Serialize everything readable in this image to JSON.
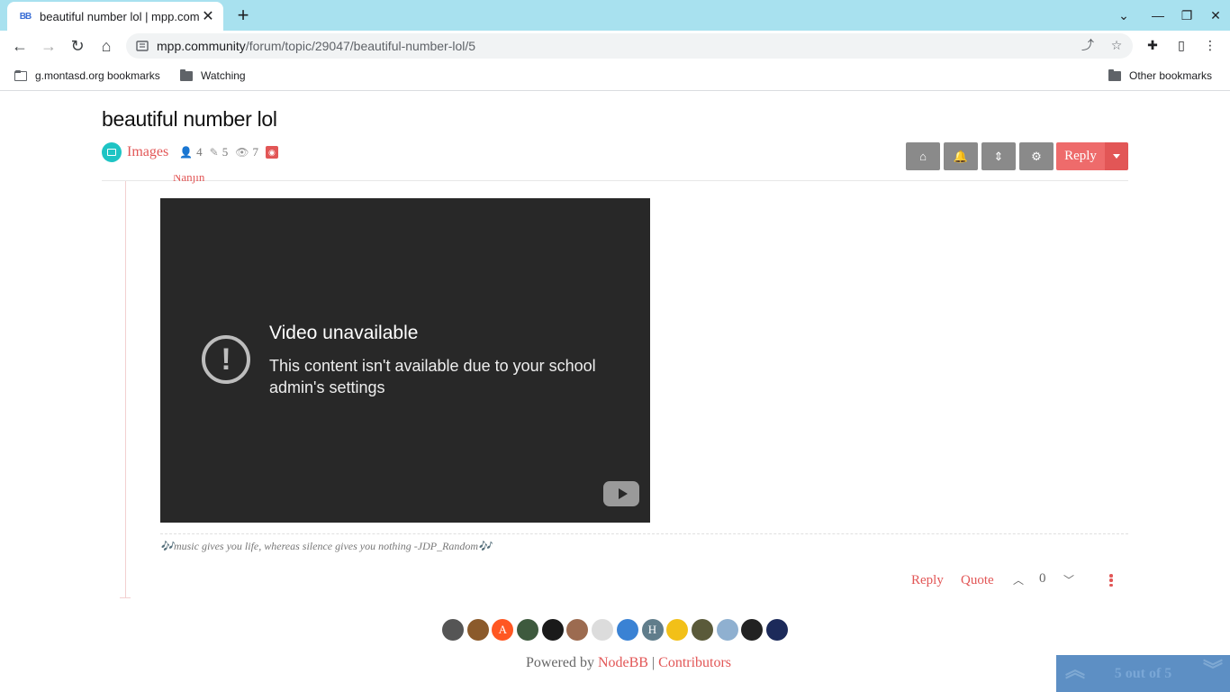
{
  "browser": {
    "tab_favicon": "BB",
    "tab_title": "beautiful number lol | mpp.community",
    "url_host": "mpp.community",
    "url_path": "/forum/topic/29047/beautiful-number-lol/5",
    "bookmarks": [
      {
        "label": "g.montasd.org bookmarks",
        "icon": "folder-outline-icon"
      },
      {
        "label": "Watching",
        "icon": "folder-icon"
      }
    ],
    "other_bookmarks": "Other bookmarks"
  },
  "topic": {
    "title": "beautiful number lol",
    "category": "Images",
    "posters": "4",
    "posts": "5",
    "views": "7",
    "reply_label": "Reply"
  },
  "post": {
    "author_cut": "Nanjin",
    "video": {
      "title": "Video unavailable",
      "message": "This content isn't available due to your school admin's settings"
    },
    "signature": "🎶music gives you life, whereas silence gives you nothing -JDP_Random🎶",
    "reply": "Reply",
    "quote": "Quote",
    "votes": "0"
  },
  "footer": {
    "avatars": [
      {
        "color": "#555555",
        "letter": ""
      },
      {
        "color": "#8b5a2b",
        "letter": ""
      },
      {
        "color": "#ff5722",
        "letter": "A"
      },
      {
        "color": "#3e5a3e",
        "letter": ""
      },
      {
        "color": "#1a1a1a",
        "letter": ""
      },
      {
        "color": "#9c6b50",
        "letter": ""
      },
      {
        "color": "#dcdcdc",
        "letter": ""
      },
      {
        "color": "#3a82d4",
        "letter": ""
      },
      {
        "color": "#607d8b",
        "letter": "H"
      },
      {
        "color": "#f2c018",
        "letter": ""
      },
      {
        "color": "#5a5a3a",
        "letter": ""
      },
      {
        "color": "#8fb0d0",
        "letter": ""
      },
      {
        "color": "#222222",
        "letter": ""
      },
      {
        "color": "#1c2a5a",
        "letter": ""
      }
    ],
    "powered_by": "Powered by",
    "nodebb": "NodeBB",
    "separator": "|",
    "contributors": "Contributors"
  },
  "pagination": {
    "label": "5 out of 5"
  },
  "colors": {
    "accent": "#e25656",
    "category": "#1ec4c4",
    "tabstrip": "#a8e1ef"
  }
}
